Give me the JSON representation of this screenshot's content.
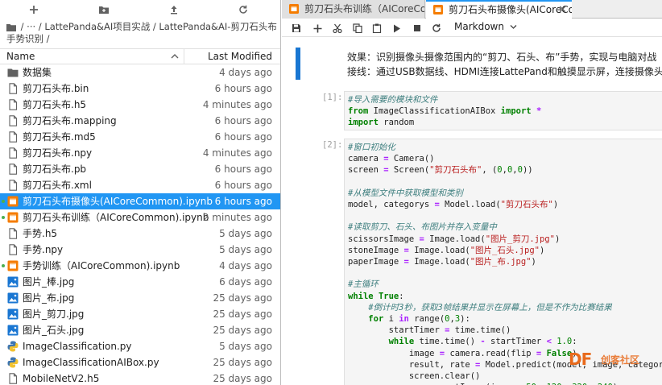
{
  "breadcrumb": "/ ··· / LattePanda&AI项目实战 / LattePanda&AI-剪刀石头布手势识别 /",
  "file_header": {
    "name": "Name",
    "modified": "Last Modified"
  },
  "files": [
    {
      "name": "数据集",
      "modified": "4 days ago",
      "icon": "folder-icon",
      "selected": false,
      "running": false
    },
    {
      "name": "剪刀石头布.bin",
      "modified": "6 hours ago",
      "icon": "file-icon",
      "selected": false,
      "running": false
    },
    {
      "name": "剪刀石头布.h5",
      "modified": "4 minutes ago",
      "icon": "file-icon",
      "selected": false,
      "running": false
    },
    {
      "name": "剪刀石头布.mapping",
      "modified": "6 hours ago",
      "icon": "file-icon",
      "selected": false,
      "running": false
    },
    {
      "name": "剪刀石头布.md5",
      "modified": "6 hours ago",
      "icon": "file-icon",
      "selected": false,
      "running": false
    },
    {
      "name": "剪刀石头布.npy",
      "modified": "4 minutes ago",
      "icon": "file-icon",
      "selected": false,
      "running": false
    },
    {
      "name": "剪刀石头布.pb",
      "modified": "6 hours ago",
      "icon": "file-icon",
      "selected": false,
      "running": false
    },
    {
      "name": "剪刀石头布.xml",
      "modified": "6 hours ago",
      "icon": "file-icon",
      "selected": false,
      "running": false
    },
    {
      "name": "剪刀石头布摄像头(AICoreCommon).ipynb",
      "modified": "6 hours ago",
      "icon": "notebook-icon",
      "selected": true,
      "running": true
    },
    {
      "name": "剪刀石头布训练（AICoreCommon).ipynb",
      "modified": "2 minutes ago",
      "icon": "notebook-icon",
      "selected": false,
      "running": true
    },
    {
      "name": "手势.h5",
      "modified": "5 days ago",
      "icon": "file-icon",
      "selected": false,
      "running": false
    },
    {
      "name": "手势.npy",
      "modified": "5 days ago",
      "icon": "file-icon",
      "selected": false,
      "running": false
    },
    {
      "name": "手势训练（AICoreCommon).ipynb",
      "modified": "4 days ago",
      "icon": "notebook-icon",
      "selected": false,
      "running": true
    },
    {
      "name": "图片_棒.jpg",
      "modified": "6 days ago",
      "icon": "image-icon",
      "selected": false,
      "running": false
    },
    {
      "name": "图片_布.jpg",
      "modified": "25 days ago",
      "icon": "image-icon",
      "selected": false,
      "running": false
    },
    {
      "name": "图片_剪刀.jpg",
      "modified": "25 days ago",
      "icon": "image-icon",
      "selected": false,
      "running": false
    },
    {
      "name": "图片_石头.jpg",
      "modified": "25 days ago",
      "icon": "image-icon",
      "selected": false,
      "running": false
    },
    {
      "name": "ImageClassification.py",
      "modified": "5 days ago",
      "icon": "python-icon",
      "selected": false,
      "running": false
    },
    {
      "name": "ImageClassificationAIBox.py",
      "modified": "25 days ago",
      "icon": "python-icon",
      "selected": false,
      "running": false
    },
    {
      "name": "MobileNetV2.h5",
      "modified": "25 days ago",
      "icon": "file-icon",
      "selected": false,
      "running": false
    }
  ],
  "tabs": [
    {
      "label": "剪刀石头布训练（AICoreCo"
    },
    {
      "label": "剪刀石头布摄像头(AICoreCo"
    }
  ],
  "toolbar": {
    "cell_type": "Markdown"
  },
  "markdown": {
    "line1": "效果：识别摄像头摄像范围内的“剪刀、石头、布”手势，实现与电脑对战",
    "line2": "接线：通过USB数据线、HDMI连接LattePand和触摸显示屏，连接摄像头"
  },
  "cells": [
    {
      "prompt": "[1]:"
    },
    {
      "prompt": "[2]:"
    }
  ],
  "watermark": {
    "logo": "DF",
    "text": "创客社区"
  }
}
